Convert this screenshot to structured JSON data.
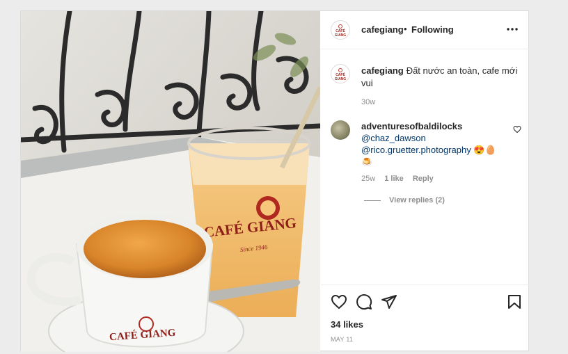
{
  "post": {
    "username": "cafegiang",
    "separator": "•",
    "follow_status": "Following",
    "photo_text": {
      "glass_brand": "CAFÉ GIANG",
      "glass_since": "Since 1946",
      "cup_brand": "CAFÉ GIANG"
    },
    "caption": {
      "username": "cafegiang",
      "text": "Đất nước an toàn, cafe mới vui",
      "time": "30w"
    },
    "comments": [
      {
        "username": "adventuresofbaldilocks",
        "mention1": "@chaz_dawson",
        "mention2": "@rico.gruetter.photography",
        "emoji": "😍🥚",
        "emoji2": "🍮",
        "time": "25w",
        "likes": "1 like",
        "reply_label": "Reply",
        "view_replies": "View replies (2)"
      }
    ],
    "likes_text": "34 likes",
    "date": "MAY 11",
    "avatar_logo": "CAFÉ GIANG"
  }
}
